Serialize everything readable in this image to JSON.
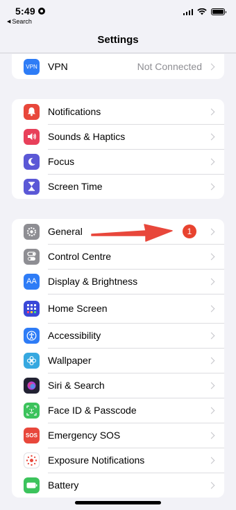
{
  "status": {
    "time": "5:49",
    "back_label": "Search"
  },
  "nav": {
    "title": "Settings"
  },
  "groups": [
    {
      "items": [
        {
          "label": "VPN",
          "value": "Not Connected",
          "icon": "vpn-icon",
          "icon_text": "VPN",
          "color": "#2e7cf6"
        }
      ]
    },
    {
      "items": [
        {
          "label": "Notifications",
          "icon": "bell-icon",
          "color": "#e8473b"
        },
        {
          "label": "Sounds & Haptics",
          "icon": "speaker-icon",
          "color": "#e8405a"
        },
        {
          "label": "Focus",
          "icon": "moon-icon",
          "color": "#5b58d6"
        },
        {
          "label": "Screen Time",
          "icon": "hourglass-icon",
          "color": "#5b58d6"
        }
      ]
    },
    {
      "items": [
        {
          "label": "General",
          "badge": "1",
          "icon": "gear-icon",
          "color": "#8e8e93"
        },
        {
          "label": "Control Centre",
          "icon": "toggles-icon",
          "color": "#8e8e93"
        },
        {
          "label": "Display & Brightness",
          "icon": "display-icon",
          "icon_text": "AA",
          "color": "#2e7cf6"
        },
        {
          "label": "Home Screen",
          "icon": "grid-icon",
          "color": "#3a48d8"
        },
        {
          "label": "Accessibility",
          "icon": "accessibility-icon",
          "color": "#2e7cf6"
        },
        {
          "label": "Wallpaper",
          "icon": "flower-icon",
          "color": "#36a8e0"
        },
        {
          "label": "Siri & Search",
          "icon": "siri-icon",
          "color": "#222233"
        },
        {
          "label": "Face ID & Passcode",
          "icon": "face-id-icon",
          "color": "#3cc35c"
        },
        {
          "label": "Emergency SOS",
          "icon": "sos-icon",
          "icon_text": "SOS",
          "color": "#e8473b"
        },
        {
          "label": "Exposure Notifications",
          "icon": "exposure-icon",
          "color": "#ffffff"
        },
        {
          "label": "Battery",
          "icon": "battery-icon",
          "color": "#3cc35c"
        }
      ]
    }
  ]
}
